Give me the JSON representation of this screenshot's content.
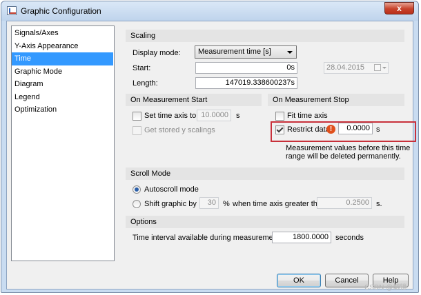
{
  "window": {
    "title": "Graphic Configuration",
    "close_glyph": "x"
  },
  "sidebar": {
    "items": [
      {
        "label": "Signals/Axes",
        "selected": false
      },
      {
        "label": "Y-Axis Appearance",
        "selected": false
      },
      {
        "label": "Time",
        "selected": true
      },
      {
        "label": "Graphic Mode",
        "selected": false
      },
      {
        "label": "Diagram",
        "selected": false
      },
      {
        "label": "Legend",
        "selected": false
      },
      {
        "label": "Optimization",
        "selected": false
      }
    ]
  },
  "scaling": {
    "header": "Scaling",
    "display_mode_label": "Display mode:",
    "display_mode_value": "Measurement time [s]",
    "start_label": "Start:",
    "start_value": "0s",
    "start_date": "28.04.2015",
    "length_label": "Length:",
    "length_value": "147019.338600237s"
  },
  "on_start": {
    "header": "On Measurement Start",
    "set_time_axis_label": "Set time axis to",
    "set_time_axis_checked": false,
    "set_time_axis_value": "10.0000",
    "set_time_axis_unit": "s",
    "get_stored_label": "Get stored y scalings",
    "get_stored_checked": false
  },
  "on_stop": {
    "header": "On Measurement Stop",
    "fit_time_axis_label": "Fit time axis",
    "fit_time_axis_checked": false,
    "restrict_data_label": "Restrict data",
    "restrict_data_checked": true,
    "restrict_data_value": "0.0000",
    "restrict_data_unit": "s",
    "warning_glyph": "!",
    "warning_line1": "Measurement values before this time",
    "warning_line2": "range will be deleted permanently."
  },
  "scroll_mode": {
    "header": "Scroll Mode",
    "autoscroll_label": "Autoscroll mode",
    "autoscroll_selected": true,
    "shift_label": "Shift graphic by",
    "shift_selected": false,
    "shift_value": "30",
    "shift_percent": "%",
    "shift_condition": "when time axis greater than",
    "shift_threshold": "0.2500",
    "shift_unit": "s."
  },
  "options": {
    "header": "Options",
    "interval_label": "Time interval available during measurement:",
    "interval_value": "1800.0000",
    "interval_unit": "seconds"
  },
  "buttons": {
    "ok": "OK",
    "cancel": "Cancel",
    "help": "Help"
  },
  "watermark": "CSDN @烟锁",
  "colors": {
    "selection": "#3399ff",
    "highlight_border": "#c8303a",
    "warning": "#e0501c",
    "section_bg": "#e4e4e4"
  }
}
